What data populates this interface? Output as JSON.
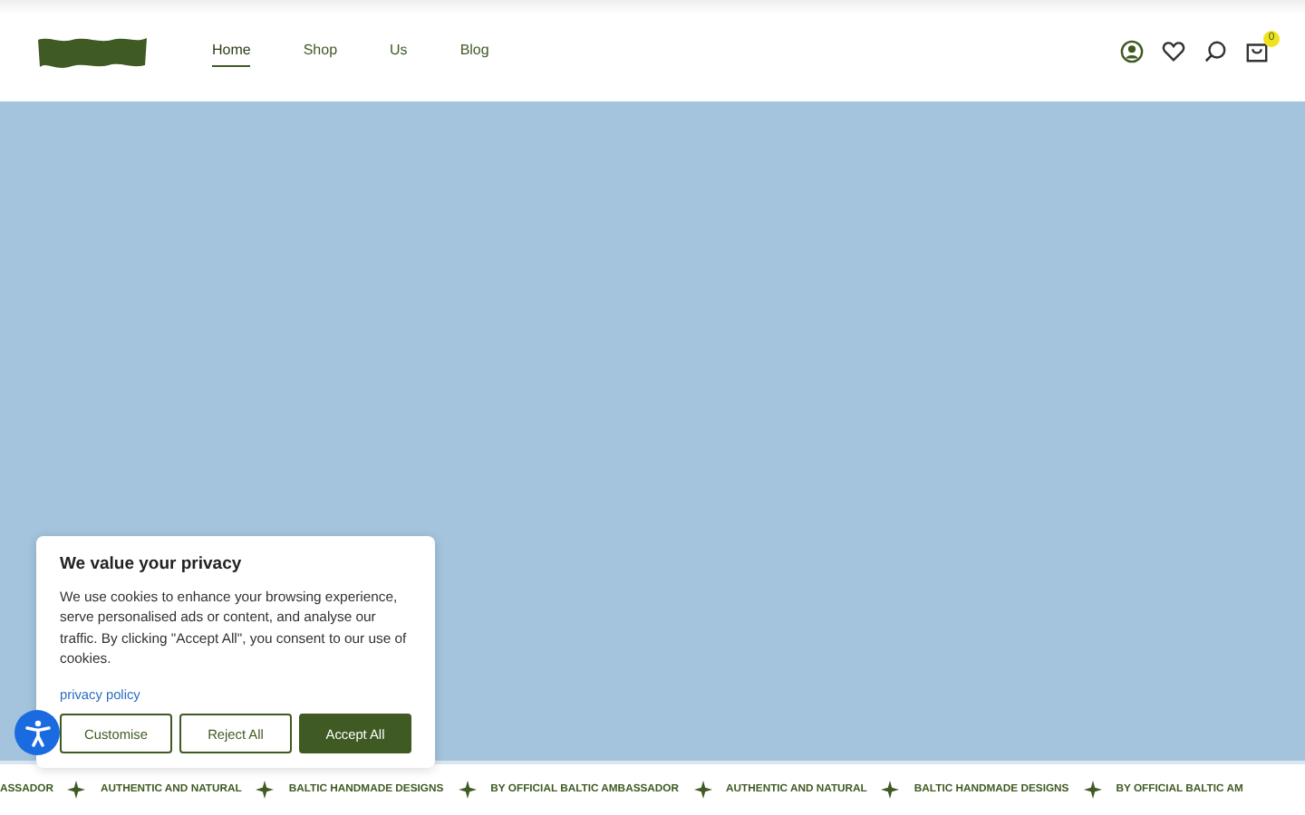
{
  "header": {
    "nav": [
      {
        "label": "Home",
        "selected": true
      },
      {
        "label": "Shop",
        "selected": false
      },
      {
        "label": "Us",
        "selected": false
      },
      {
        "label": "Blog",
        "selected": false
      }
    ],
    "cart_count": "0"
  },
  "cookie_banner": {
    "title": "We value your privacy",
    "text": "We use cookies to enhance your browsing experience, serve personalised ads or content, and analyse our traffic. By clicking \"Accept All\", you consent to our use of cookies.",
    "link": "privacy policy",
    "buttons": [
      {
        "label": "Customise",
        "kind": "outline"
      },
      {
        "label": "Reject All",
        "kind": "outline"
      },
      {
        "label": "Accept All",
        "kind": "primary"
      }
    ]
  },
  "marquee": [
    "ASSADOR",
    "AUTHENTIC AND NATURAL",
    "BALTIC HANDMADE DESIGNS",
    "BY OFFICIAL BALTIC AMBASSADOR",
    "AUTHENTIC AND NATURAL",
    "BALTIC HANDMADE DESIGNS",
    "BY OFFICIAL BALTIC AM"
  ]
}
